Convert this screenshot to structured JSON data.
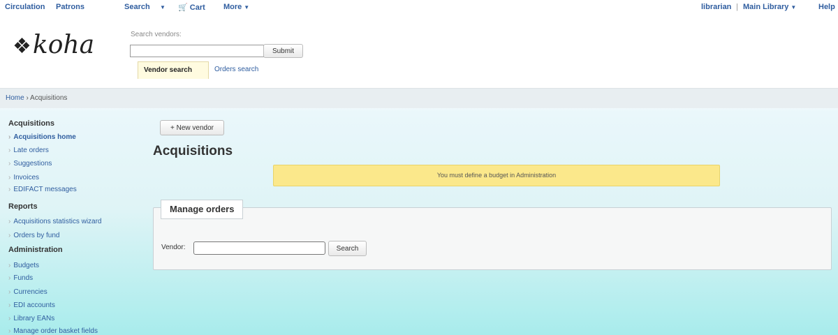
{
  "topnav": {
    "circulation": "Circulation",
    "patrons": "Patrons",
    "search": "Search",
    "cart": "Cart",
    "more": "More",
    "user": "librarian",
    "separator": "|",
    "library": "Main Library",
    "help": "Help"
  },
  "logo": {
    "text": "koha"
  },
  "search": {
    "label": "Search vendors:",
    "value": "",
    "submit": "Submit",
    "tabs": [
      "Vendor search",
      "Orders search"
    ]
  },
  "breadcrumb": {
    "home": "Home",
    "separator": "›",
    "current": "Acquisitions"
  },
  "sidebar": {
    "sections": [
      {
        "heading": "Acquisitions",
        "items": [
          "Acquisitions home",
          "Late orders",
          "Suggestions",
          "Invoices",
          "EDIFACT messages"
        ]
      },
      {
        "heading": "Reports",
        "items": [
          "Acquisitions statistics wizard",
          "Orders by fund"
        ]
      },
      {
        "heading": "Administration",
        "items": [
          "Budgets",
          "Funds",
          "Currencies",
          "EDI accounts",
          "Library EANs",
          "Manage order basket fields"
        ]
      }
    ]
  },
  "main": {
    "new_vendor": "New vendor",
    "title": "Acquisitions",
    "warning": "You must define a budget in Administration",
    "manage_orders": {
      "legend": "Manage orders",
      "vendor_label": "Vendor:",
      "vendor_value": "",
      "search_button": "Search"
    }
  },
  "colors": {
    "link": "#2f5d9f",
    "warning_bg": "#fbe88b",
    "active_tab_bg": "#fffbe0"
  }
}
